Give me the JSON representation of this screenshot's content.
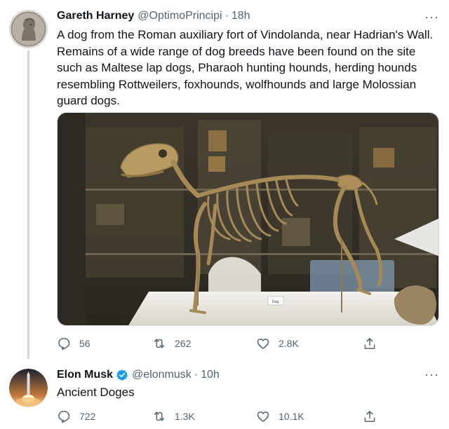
{
  "tweets": [
    {
      "author_name": "Gareth Harney",
      "author_handle": "@OptimoPrincipi",
      "separator": "·",
      "time": "18h",
      "text": "A dog from the Roman auxiliary fort of Vindolanda, near Hadrian's Wall. Remains of a wide range of dog breeds have been found on the site such as Maltese lap dogs, Pharaoh hunting hounds, herding hounds resembling Rottweilers, foxhounds, wolfhounds and large Molossian guard dogs.",
      "replies": "56",
      "retweets": "262",
      "likes": "2.8K",
      "verified": false,
      "avatar_icon": "roman-coin-portrait",
      "media_icon": "dog-skeleton-photo",
      "media_label": "Dog"
    },
    {
      "author_name": "Elon Musk",
      "author_handle": "@elonmusk",
      "separator": "·",
      "time": "10h",
      "text": "Ancient Doges",
      "replies": "722",
      "retweets": "1.3K",
      "likes": "10.1K",
      "verified": true,
      "avatar_icon": "rocket-launch-portrait"
    }
  ],
  "more_label": "···",
  "colors": {
    "accent": "#1d9bf0",
    "text": "#0f1419",
    "muted": "#536471",
    "border": "#cfd9de"
  }
}
